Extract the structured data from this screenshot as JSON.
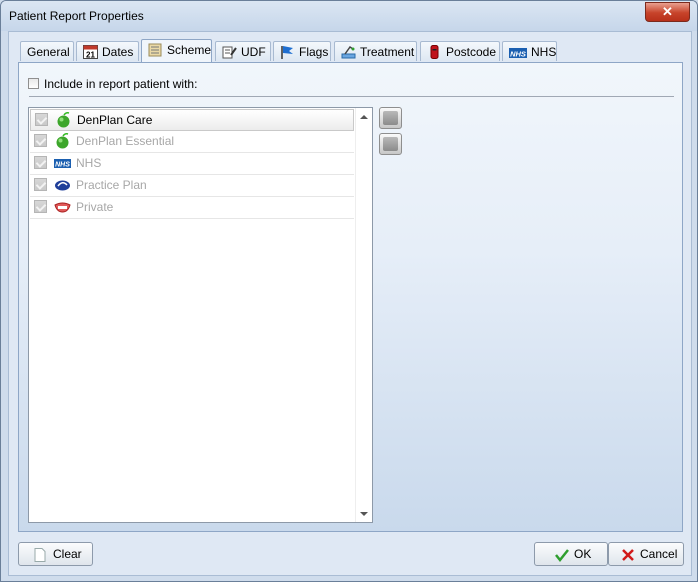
{
  "window": {
    "title": "Patient Report Properties",
    "close_label": "✕"
  },
  "tabs": [
    {
      "label": "General",
      "icon": "none"
    },
    {
      "label": "Dates",
      "icon": "calendar-icon",
      "icon_text": "21"
    },
    {
      "label": "Scheme",
      "icon": "scheme-icon",
      "active": true
    },
    {
      "label": "UDF",
      "icon": "udf-icon"
    },
    {
      "label": "Flags",
      "icon": "flag-icon"
    },
    {
      "label": "Treatment",
      "icon": "treatment-icon"
    },
    {
      "label": "Postcode",
      "icon": "postcode-icon"
    },
    {
      "label": "NHS",
      "icon": "nhs-icon",
      "icon_text": "NHS"
    }
  ],
  "filter": {
    "include_label": "Include in report patient with:",
    "checked": false
  },
  "schemes": [
    {
      "label": "DenPlan Care",
      "icon": "apple-icon",
      "checked": true,
      "selected": true
    },
    {
      "label": "DenPlan Essential",
      "icon": "apple-icon",
      "checked": true
    },
    {
      "label": "NHS",
      "icon": "nhs-icon",
      "icon_text": "NHS",
      "checked": true
    },
    {
      "label": "Practice Plan",
      "icon": "practice-plan-icon",
      "checked": true
    },
    {
      "label": "Private",
      "icon": "private-icon",
      "checked": true
    }
  ],
  "buttons": {
    "clear": "Clear",
    "ok": "OK",
    "cancel": "Cancel"
  },
  "colors": {
    "accent": "#8ea6c6",
    "window_bg": "#cfdcec",
    "close_red": "#c7432a",
    "ok_green": "#2e9e2e",
    "cancel_red": "#d11919"
  }
}
